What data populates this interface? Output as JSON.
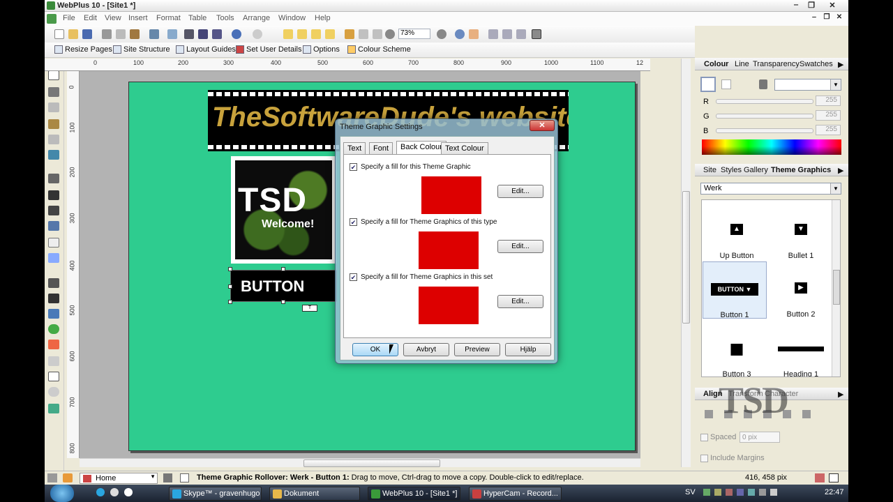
{
  "app": {
    "title": "WebPlus 10 - [Site1 *]"
  },
  "menu": [
    "File",
    "Edit",
    "View",
    "Insert",
    "Format",
    "Table",
    "Tools",
    "Arrange",
    "Window",
    "Help"
  ],
  "toolbar": {
    "zoom": "73%"
  },
  "toolbar2": [
    {
      "label": "Resize Pages",
      "icon": "resize-pages-icon"
    },
    {
      "label": "Site Structure",
      "icon": "site-structure-icon"
    },
    {
      "label": "Layout Guides",
      "icon": "layout-guides-icon"
    },
    {
      "label": "Set User Details",
      "icon": "user-details-icon"
    },
    {
      "label": "Options",
      "icon": "options-icon"
    },
    {
      "label": "Colour Scheme",
      "icon": "colour-scheme-icon"
    }
  ],
  "ruler_h": [
    "0",
    "100",
    "200",
    "300",
    "400",
    "500",
    "600",
    "700",
    "800",
    "900",
    "1000",
    "1100",
    "12"
  ],
  "ruler_v": [
    "0",
    "100",
    "200",
    "300",
    "400",
    "500",
    "600",
    "700",
    "800"
  ],
  "canvas": {
    "banner_title": "TheSoftwareDude's website",
    "logo_main": "TSD",
    "logo_sub": "Welcome!",
    "button_text": "BUTTON"
  },
  "colour_panel": {
    "tabs": [
      "Colour",
      "Line",
      "Transparency",
      "Swatches"
    ],
    "channels": [
      {
        "label": "R",
        "value": "255"
      },
      {
        "label": "G",
        "value": "255"
      },
      {
        "label": "B",
        "value": "255"
      }
    ]
  },
  "theme_panel": {
    "tabs": [
      "Site",
      "Styles",
      "Gallery",
      "Theme Graphics"
    ],
    "set": "Werk",
    "items": [
      {
        "label": "Up Button",
        "icon": "up-triangle-icon"
      },
      {
        "label": "Bullet 1",
        "icon": "down-triangle-icon"
      },
      {
        "label": "Button 1",
        "icon": "button-preview-icon",
        "preview_text": "BUTTON"
      },
      {
        "label": "Button 2",
        "icon": "right-triangle-icon"
      },
      {
        "label": "Button 3",
        "icon": "square-icon"
      },
      {
        "label": "Heading 1",
        "icon": "heading-bar-icon"
      }
    ]
  },
  "align_panel": {
    "tabs": [
      "Align",
      "Transform",
      "Character"
    ],
    "spaced_label": "Spaced",
    "spaced_value": "0 pix",
    "include_margins": "Include Margins"
  },
  "dialog": {
    "title": "Theme Graphic Settings",
    "tabs": [
      "Text",
      "Font",
      "Back Colour",
      "Text Colour"
    ],
    "active_tab": "Back Colour",
    "fills": [
      {
        "label": "Specify a fill for this Theme Graphic",
        "checked": true,
        "edit": "Edit...",
        "color": "#dd0000"
      },
      {
        "label": "Specify a fill for Theme Graphics of this type",
        "checked": true,
        "edit": "Edit...",
        "color": "#dd0000"
      },
      {
        "label": "Specify a fill for Theme Graphics in this set",
        "checked": true,
        "edit": "Edit...",
        "color": "#dd0000"
      }
    ],
    "buttons": [
      "OK",
      "Avbryt",
      "Preview",
      "Hjälp"
    ]
  },
  "status": {
    "page": "Home",
    "message_bold": "Theme Graphic Rollover: Werk - Button 1:",
    "message": " Drag to move, Ctrl-drag to move a copy. Double-click to edit/replace.",
    "coords": "416, 458 pix"
  },
  "taskbar": {
    "tasks": [
      {
        "label": "Skype™ - gravenhugo",
        "icon": "skype-icon",
        "color": "#2aa6e0"
      },
      {
        "label": "Dokument",
        "icon": "folder-icon",
        "color": "#e8b84a"
      },
      {
        "label": "WebPlus 10 - [Site1 *]",
        "icon": "webplus-icon",
        "color": "#3a9a3a"
      },
      {
        "label": "HyperCam - Record...",
        "icon": "hypercam-icon",
        "color": "#c84040"
      }
    ],
    "lang": "SV",
    "time": "22:47"
  },
  "watermark": "TSD",
  "colors": {
    "page_bg": "#2ecc8f",
    "fill_red": "#dd0000",
    "banner_gold": "#c8a23c"
  }
}
